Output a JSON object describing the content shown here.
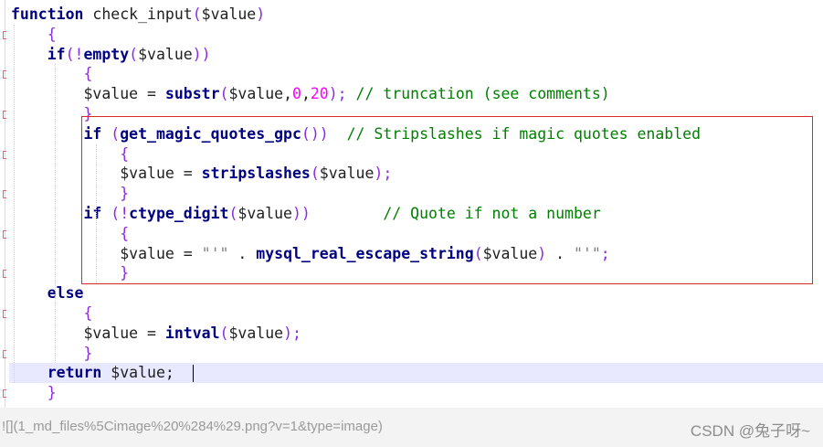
{
  "code": {
    "lines": [
      [
        {
          "t": "function",
          "c": "kw"
        },
        {
          "t": " check_input",
          "c": "plain"
        },
        {
          "t": "(",
          "c": "br"
        },
        {
          "t": "$value",
          "c": "var"
        },
        {
          "t": ")",
          "c": "br"
        }
      ],
      [
        {
          "t": "    ",
          "c": "plain"
        },
        {
          "t": "{",
          "c": "br"
        }
      ],
      [
        {
          "t": "    ",
          "c": "plain"
        },
        {
          "t": "if",
          "c": "kw"
        },
        {
          "t": "(!",
          "c": "br"
        },
        {
          "t": "empty",
          "c": "fn"
        },
        {
          "t": "(",
          "c": "br"
        },
        {
          "t": "$value",
          "c": "var"
        },
        {
          "t": "))",
          "c": "br"
        }
      ],
      [
        {
          "t": "        ",
          "c": "plain"
        },
        {
          "t": "{",
          "c": "br"
        }
      ],
      [
        {
          "t": "        ",
          "c": "plain"
        },
        {
          "t": "$value",
          "c": "var"
        },
        {
          "t": " = ",
          "c": "op"
        },
        {
          "t": "substr",
          "c": "fn"
        },
        {
          "t": "(",
          "c": "br"
        },
        {
          "t": "$value",
          "c": "var"
        },
        {
          "t": ",",
          "c": "op"
        },
        {
          "t": "0",
          "c": "num"
        },
        {
          "t": ",",
          "c": "op"
        },
        {
          "t": "20",
          "c": "num"
        },
        {
          "t": ");",
          "c": "br"
        },
        {
          "t": " // truncation (see comments)",
          "c": "cm"
        }
      ],
      [
        {
          "t": "        ",
          "c": "plain"
        },
        {
          "t": "}",
          "c": "br"
        }
      ],
      [
        {
          "t": "        ",
          "c": "plain"
        },
        {
          "t": "if",
          "c": "kw"
        },
        {
          "t": " (",
          "c": "br"
        },
        {
          "t": "get_magic_quotes_gpc",
          "c": "fn"
        },
        {
          "t": "())",
          "c": "br"
        },
        {
          "t": "  // Stripslashes if magic quotes enabled",
          "c": "cm"
        }
      ],
      [
        {
          "t": "            ",
          "c": "plain"
        },
        {
          "t": "{",
          "c": "br"
        }
      ],
      [
        {
          "t": "            ",
          "c": "plain"
        },
        {
          "t": "$value",
          "c": "var"
        },
        {
          "t": " = ",
          "c": "op"
        },
        {
          "t": "stripslashes",
          "c": "fn"
        },
        {
          "t": "(",
          "c": "br"
        },
        {
          "t": "$value",
          "c": "var"
        },
        {
          "t": ");",
          "c": "br"
        }
      ],
      [
        {
          "t": "            ",
          "c": "plain"
        },
        {
          "t": "}",
          "c": "br"
        }
      ],
      [
        {
          "t": "        ",
          "c": "plain"
        },
        {
          "t": "if",
          "c": "kw"
        },
        {
          "t": " (!",
          "c": "br"
        },
        {
          "t": "ctype_digit",
          "c": "fn"
        },
        {
          "t": "(",
          "c": "br"
        },
        {
          "t": "$value",
          "c": "var"
        },
        {
          "t": "))",
          "c": "br"
        },
        {
          "t": "        // Quote if not a number",
          "c": "cm"
        }
      ],
      [
        {
          "t": "            ",
          "c": "plain"
        },
        {
          "t": "{",
          "c": "br"
        }
      ],
      [
        {
          "t": "            ",
          "c": "plain"
        },
        {
          "t": "$value",
          "c": "var"
        },
        {
          "t": " = ",
          "c": "op"
        },
        {
          "t": "\"'\"",
          "c": "str"
        },
        {
          "t": " . ",
          "c": "op"
        },
        {
          "t": "mysql_real_escape_string",
          "c": "fn"
        },
        {
          "t": "(",
          "c": "br"
        },
        {
          "t": "$value",
          "c": "var"
        },
        {
          "t": ")",
          "c": "br"
        },
        {
          "t": " . ",
          "c": "op"
        },
        {
          "t": "\"'\"",
          "c": "str"
        },
        {
          "t": ";",
          "c": "br"
        }
      ],
      [
        {
          "t": "            ",
          "c": "plain"
        },
        {
          "t": "}",
          "c": "br"
        }
      ],
      [
        {
          "t": "    ",
          "c": "plain"
        },
        {
          "t": "else",
          "c": "kw"
        }
      ],
      [
        {
          "t": "        ",
          "c": "plain"
        },
        {
          "t": "{",
          "c": "br"
        }
      ],
      [
        {
          "t": "        ",
          "c": "plain"
        },
        {
          "t": "$value",
          "c": "var"
        },
        {
          "t": " = ",
          "c": "op"
        },
        {
          "t": "intval",
          "c": "fn"
        },
        {
          "t": "(",
          "c": "br"
        },
        {
          "t": "$value",
          "c": "var"
        },
        {
          "t": ");",
          "c": "br"
        }
      ],
      [
        {
          "t": "        ",
          "c": "plain"
        },
        {
          "t": "}",
          "c": "br"
        }
      ],
      [
        {
          "t": "    ",
          "c": "plain"
        },
        {
          "t": "return",
          "c": "kw"
        },
        {
          "t": " $value;",
          "c": "var"
        }
      ],
      [
        {
          "t": "    ",
          "c": "plain"
        },
        {
          "t": "}",
          "c": "br"
        }
      ]
    ]
  },
  "footer": {
    "broken_image_text": "![](1_md_files%5Cimage%20%284%29.png?v=1&type=image)",
    "watermark": "CSDN @兔子呀~"
  },
  "colors": {
    "highlight_box": "#d42a2a",
    "current_line": "#e8e8ff",
    "comment": "#008000",
    "keyword": "#000080"
  }
}
